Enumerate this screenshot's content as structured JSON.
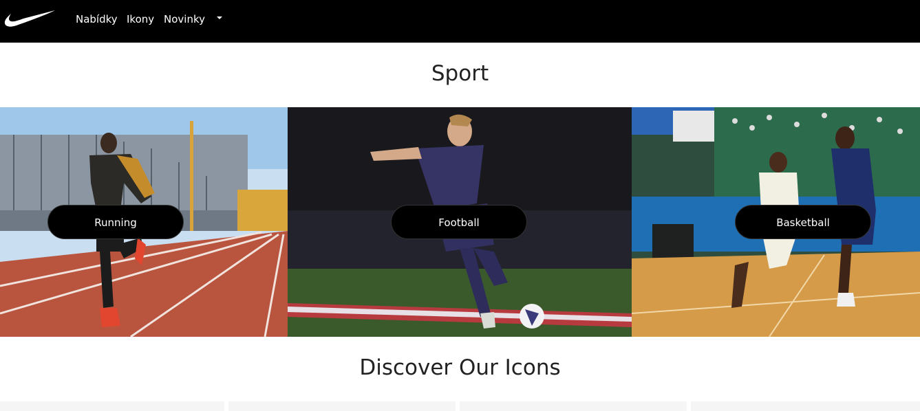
{
  "nav": {
    "logo": "swoosh-logo",
    "links": [
      "Nabídky",
      "Ikony",
      "Novinky"
    ],
    "dropdown_icon": "caret-down-icon"
  },
  "sport": {
    "title": "Sport",
    "tiles": [
      {
        "label": "Running"
      },
      {
        "label": "Football"
      },
      {
        "label": "Basketball"
      }
    ]
  },
  "icons": {
    "title": "Discover Our Icons"
  },
  "colors": {
    "nav_bg": "#000000",
    "pill_bg": "#000000",
    "card_bg": "#f5f5f5"
  }
}
